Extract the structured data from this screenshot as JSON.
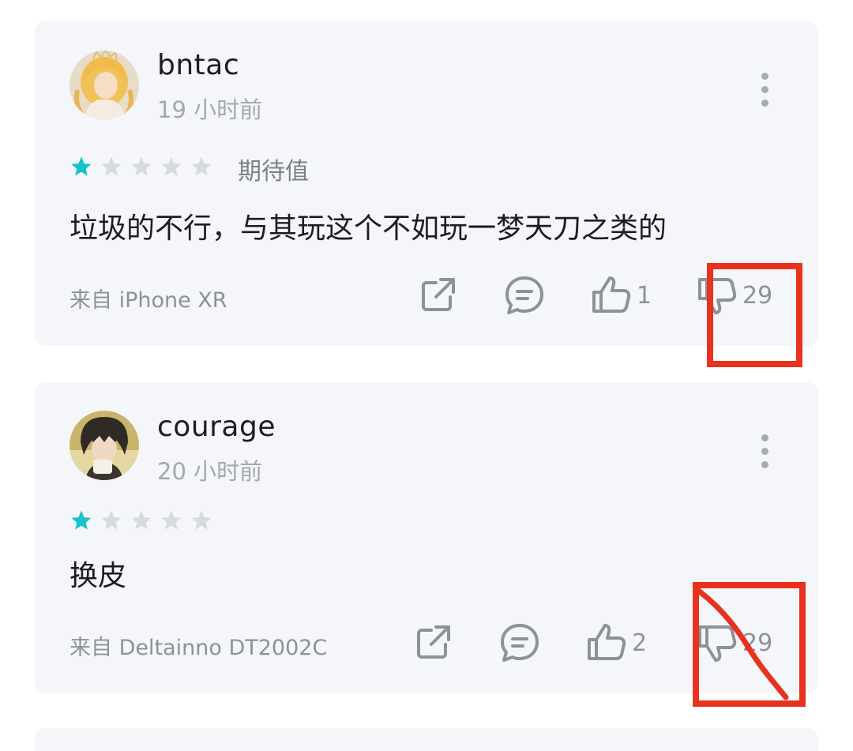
{
  "reviews": [
    {
      "username": "bntac",
      "time": "19 小时前",
      "rating": 1,
      "max_rating": 5,
      "rating_label": "期待值",
      "content": "垃圾的不行，与其玩这个不如玩一梦天刀之类的",
      "device": "来自 iPhone XR",
      "likes": "1",
      "dislikes": "29"
    },
    {
      "username": "courage",
      "time": "20 小时前",
      "rating": 1,
      "max_rating": 5,
      "rating_label": "",
      "content": "换皮",
      "device": "来自 Deltainno DT2002C",
      "likes": "2",
      "dislikes": "29"
    }
  ],
  "colors": {
    "card_bg": "#f4f6f9",
    "star_active": "#16c3cc",
    "star_inactive": "#d7dbe0",
    "icon_gray": "#8d9298",
    "annotation_red": "#e8321e"
  },
  "icons": [
    "share-icon",
    "comment-icon",
    "thumbs-up-icon",
    "thumbs-down-icon",
    "more-icon",
    "star-icon"
  ]
}
